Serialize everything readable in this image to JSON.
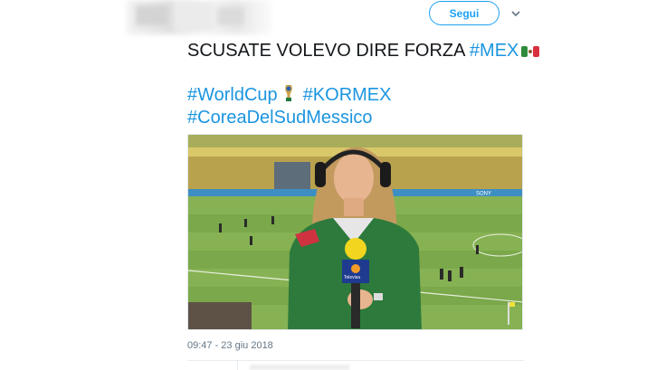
{
  "header": {
    "follow_label": "Segui"
  },
  "tweet": {
    "line1_text": "SCUSATE VOLEVO DIRE FORZA ",
    "line1_hashtag": "#MEX",
    "line2_hashtag_a": "#WorldCup",
    "line2_hashtag_b": "#KORMEX",
    "line3_hashtag": "#CoreaDelSudMessico",
    "timestamp": "09:47 - 23 giu 2018"
  },
  "media": {
    "microphone_brand": "Televisa",
    "ad_board_text": "SONY"
  },
  "icons": {
    "more_menu": "chevron-down-icon",
    "flag": "mexico-flag-icon",
    "trophy": "world-cup-trophy-icon"
  },
  "colors": {
    "accent": "#1da1f2",
    "hashtag": "#1b95e0",
    "text": "#14171a",
    "meta": "#657786"
  }
}
